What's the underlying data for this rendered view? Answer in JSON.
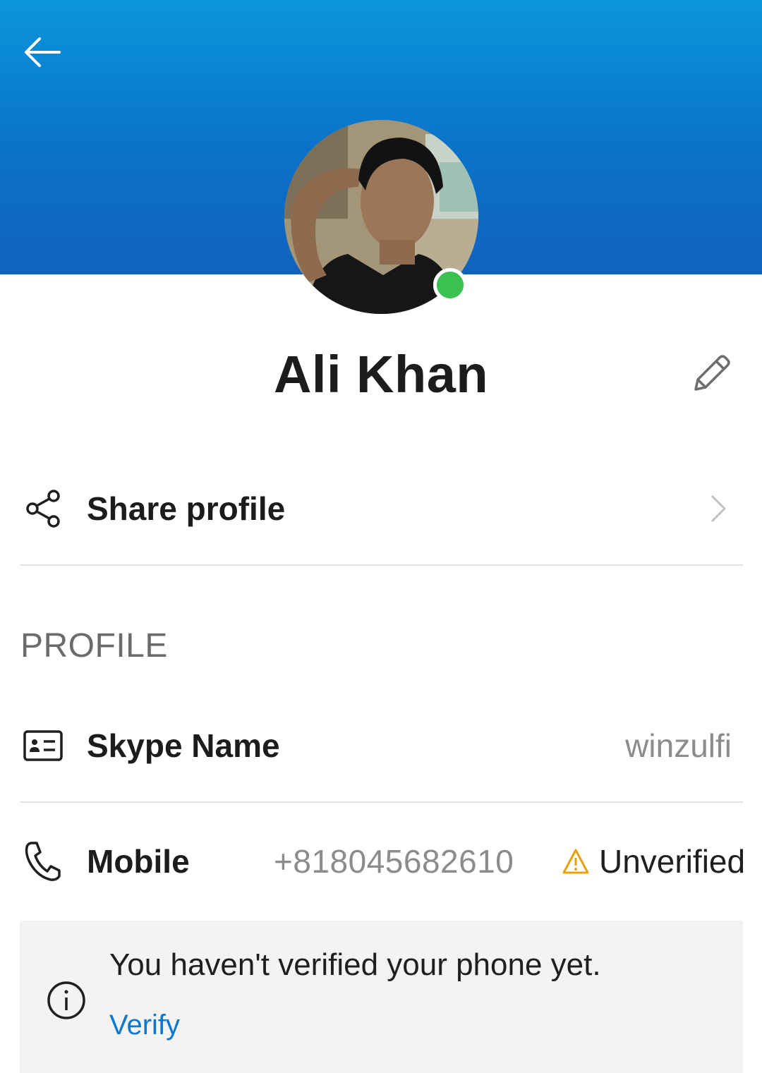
{
  "header": {
    "back_icon": "arrow-left-icon",
    "background_color": "#0b7fd4"
  },
  "profile": {
    "name": "Ali Khan",
    "presence_status_color": "#3ac152",
    "edit_icon": "pencil-icon"
  },
  "share": {
    "label": "Share profile",
    "icon": "share-icon",
    "chevron_icon": "chevron-right-icon"
  },
  "section": {
    "title": "PROFILE"
  },
  "skype_name": {
    "label": "Skype Name",
    "value": "winzulfi",
    "icon": "id-card-icon"
  },
  "mobile": {
    "label": "Mobile",
    "value": "+818045682610",
    "status": "Unverified",
    "icon": "phone-icon",
    "warning_icon": "warning-icon",
    "warning_color": "#e8a20c"
  },
  "notice": {
    "message": "You haven't verified your phone yet.",
    "link_label": "Verify",
    "icon": "info-icon",
    "link_color": "#0a78d1"
  }
}
